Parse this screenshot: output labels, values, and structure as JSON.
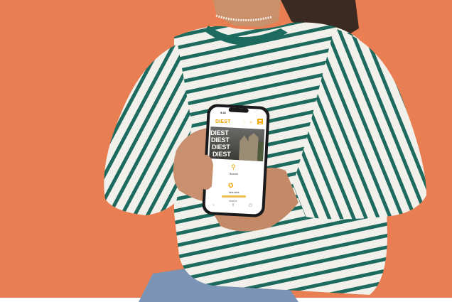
{
  "phone_screen": {
    "status_time": "9:41",
    "logo": "DIEST",
    "header_icons": [
      "heart-icon",
      "person-icon"
    ],
    "hero_words": [
      "DIEST",
      "DIEST",
      "DIEST",
      "DIEST"
    ],
    "middle_label": "Bezoek",
    "cta_label": "Vind alles",
    "address": "diest.be",
    "tab_icons": [
      "back-icon",
      "share-icon",
      "tabs-icon"
    ]
  },
  "colors": {
    "background": "#e97e53",
    "shirt_white": "#f2f0ea",
    "shirt_stripe": "#1d6b5f",
    "accent": "#f0a400"
  }
}
